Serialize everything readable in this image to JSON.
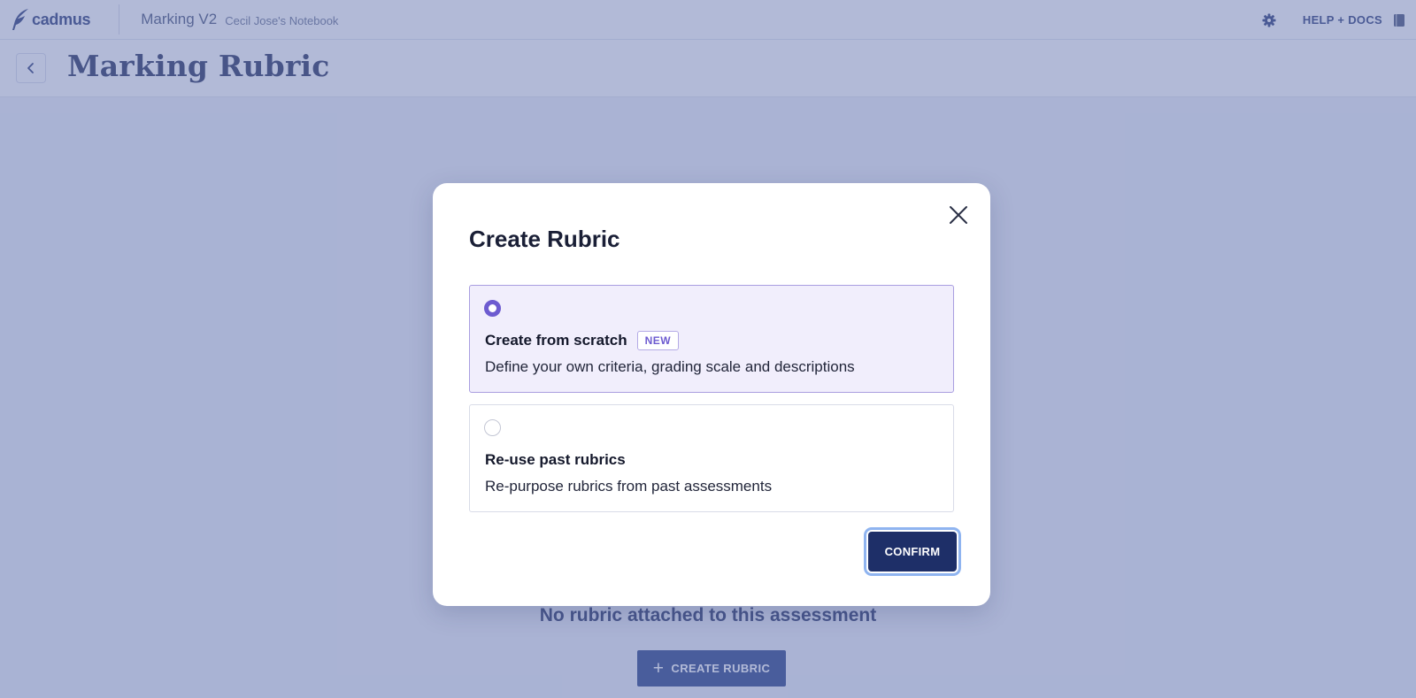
{
  "topbar": {
    "logo_text": "cadmus",
    "app_name": "Marking V2",
    "notebook_name": "Cecil Jose's Notebook",
    "settings_icon": "gear-icon",
    "help_label": "HELP + DOCS",
    "help_icon": "book-icon"
  },
  "header": {
    "back_icon": "chevron-left-icon",
    "page_title": "Marking Rubric"
  },
  "main": {
    "empty_state_text": "No rubric attached to this assessment",
    "create_button_icon": "plus-icon",
    "create_button_plus": "+",
    "create_button_label": "CREATE RUBRIC"
  },
  "modal": {
    "title": "Create Rubric",
    "close_icon": "close-icon",
    "options": [
      {
        "title": "Create from scratch",
        "badge": "NEW",
        "description": "Define your own criteria, grading scale and descriptions",
        "selected": true
      },
      {
        "title": "Re-use past rubrics",
        "description": "Re-purpose rubrics from past assessments",
        "selected": false
      }
    ],
    "confirm_label": "CONFIRM"
  },
  "colors": {
    "accent": "#6d5bd0",
    "primary_button": "#1e2f68",
    "brand": "#2e3f7a",
    "overlay": "#6576af"
  }
}
